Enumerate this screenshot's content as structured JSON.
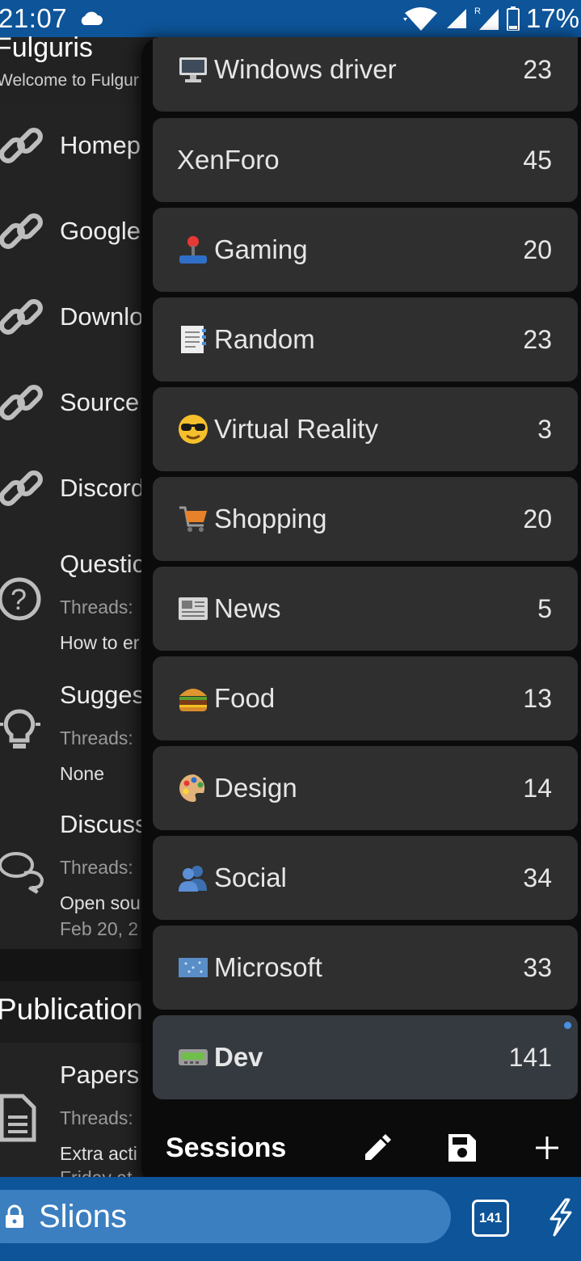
{
  "status_bar": {
    "time": "21:07",
    "battery": "17%",
    "icons": [
      "cloud-icon",
      "wifi-icon",
      "signal-icon",
      "roaming-signal-icon",
      "battery-icon"
    ]
  },
  "background_page": {
    "site_title": "Fulguris",
    "site_subtitle": "Welcome to Fulgur",
    "rows": [
      {
        "title": "Homep",
        "icon": "link-icon"
      },
      {
        "title": "Google",
        "icon": "link-icon"
      },
      {
        "title": "Downlo",
        "icon": "link-icon"
      },
      {
        "title": "Source",
        "icon": "link-icon"
      },
      {
        "title": "Discord",
        "icon": "link-icon"
      },
      {
        "title": "Questic",
        "meta": "Threads:",
        "last": "How to er",
        "icon": "question-icon"
      },
      {
        "title": "Sugges",
        "meta": "Threads:",
        "last": "None",
        "icon": "lightbulb-icon"
      },
      {
        "title": "Discuss",
        "meta": "Threads:",
        "last": "Open sou",
        "date": "Feb 20, 2",
        "icon": "chat-icon"
      },
      {
        "title": "Papers",
        "meta": "Threads:",
        "last": "Extra acti",
        "date": "Friday at",
        "icon": "document-icon"
      }
    ],
    "section_header": "Publication"
  },
  "sessions": {
    "title": "Sessions",
    "items": [
      {
        "name": "Windows driver",
        "count": "23",
        "icon": "computer-icon",
        "active": false
      },
      {
        "name": "XenForo",
        "count": "45",
        "icon": "",
        "active": false
      },
      {
        "name": "Gaming",
        "count": "20",
        "icon": "joystick-icon",
        "active": false
      },
      {
        "name": "Random",
        "count": "23",
        "icon": "notepad-icon",
        "active": false
      },
      {
        "name": "Virtual Reality",
        "count": "3",
        "icon": "sunglasses-face-icon",
        "active": false
      },
      {
        "name": "Shopping",
        "count": "20",
        "icon": "shopping-cart-icon",
        "active": false
      },
      {
        "name": "News",
        "count": "5",
        "icon": "newspaper-icon",
        "active": false
      },
      {
        "name": "Food",
        "count": "13",
        "icon": "burger-icon",
        "active": false
      },
      {
        "name": "Design",
        "count": "14",
        "icon": "palette-icon",
        "active": false
      },
      {
        "name": "Social",
        "count": "34",
        "icon": "people-icon",
        "active": false
      },
      {
        "name": "Microsoft",
        "count": "33",
        "icon": "flag-icon",
        "active": false
      },
      {
        "name": "Dev",
        "count": "141",
        "icon": "pager-icon",
        "active": true
      }
    ],
    "actions": [
      "edit-icon",
      "save-icon",
      "add-icon"
    ]
  },
  "url_bar": {
    "text": "Slions",
    "tab_count": "141"
  },
  "colors": {
    "accent": "#0d5499",
    "url_field": "#3b7fc0",
    "card": "#2f2f2f",
    "active_card": "#353a40",
    "active_dot": "#4a90e2"
  }
}
